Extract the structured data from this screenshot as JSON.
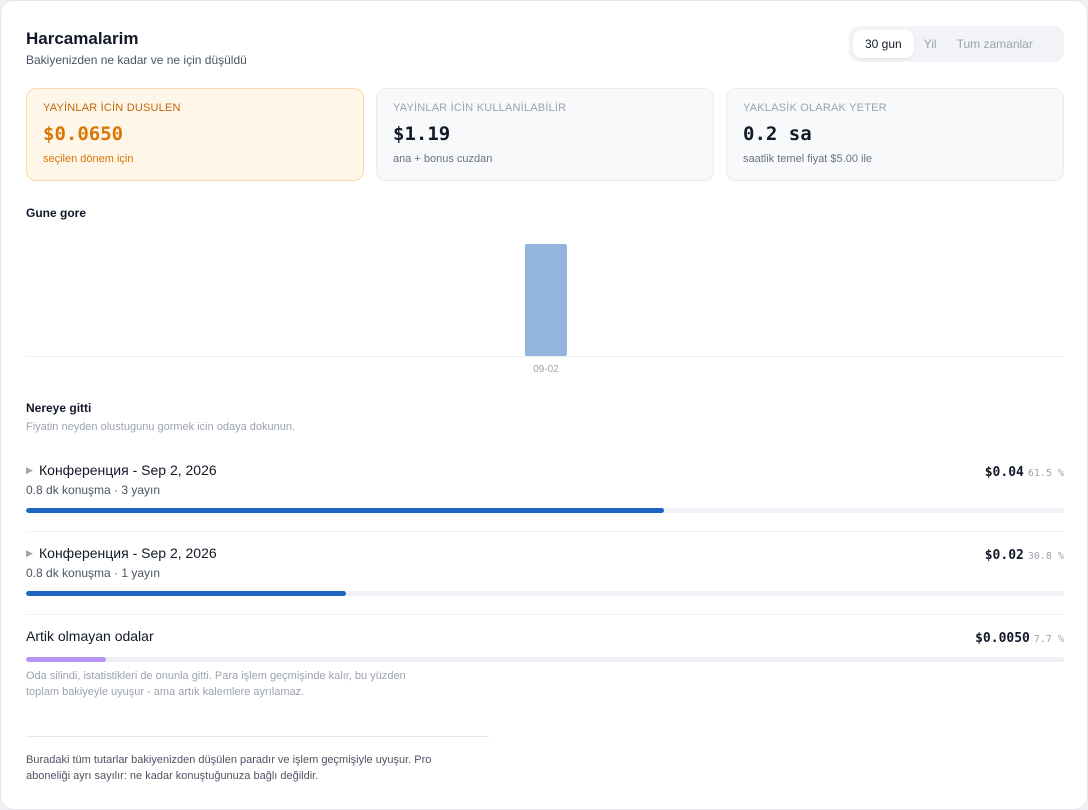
{
  "header": {
    "title": "Harcamalarim",
    "subtitle": "Bakiyenizden ne kadar ve ne için düşüldü"
  },
  "period_tabs": [
    {
      "label": "30 gun",
      "active": true
    },
    {
      "label": "Yil",
      "active": false
    },
    {
      "label": "Tum zamanlar",
      "active": false
    }
  ],
  "stats": [
    {
      "label": "YAYİNLAR İCİN DUSULEN",
      "value": "$0.0650",
      "note": "seçilen dönem için"
    },
    {
      "label": "YAYİNLAR İCİN KULLANİLABİLİR",
      "value": "$1.19",
      "note": "ana + bonus cuzdan"
    },
    {
      "label": "YAKLASİK OLARAK YETER",
      "value": "0.2 sa",
      "note": "saatlik temel fiyat $5.00 ile"
    }
  ],
  "by_day": {
    "title": "Gune gore"
  },
  "chart_data": {
    "type": "bar",
    "title": "Gune gore",
    "categories": [
      "09-02"
    ],
    "values": [
      0.065
    ],
    "xlabel": "",
    "ylabel": "",
    "ylim": [
      0,
      0.065
    ],
    "grid": false,
    "bar_color": "#93b4de"
  },
  "breakdown": {
    "title": "Nereye gitti",
    "subtitle": "Fiyatin neyden olustugunu gormek icin odaya dokunun.",
    "rooms": [
      {
        "name": "Конференция - Sep 2, 2026",
        "meta": "0.8 dk konuşma · 3 yayın",
        "amount": "$0.04",
        "percent_label": "61.5 %",
        "share": 0.615
      },
      {
        "name": "Конференция - Sep 2, 2026",
        "meta": "0.8 dk konuşma · 1 yayın",
        "amount": "$0.02",
        "percent_label": "30.8 %",
        "share": 0.308
      }
    ],
    "gone": {
      "name": "Artik olmayan odalar",
      "amount": "$0.0050",
      "percent_label": "7.7 %",
      "share": 0.077,
      "note": "Oda silindi, istatistikleri de onunla gitti. Para işlem geçmişinde kalır, bu yüzden toplam bakiyeyle uyuşur - ama artık kalemlere ayrılamaz."
    }
  },
  "footer_note": "Buradaki tüm tutarlar bakiyenizden düşülen paradır ve işlem geçmişiyle uyuşur. Pro aboneliği ayrı sayılır: ne kadar konuştuğunuza bağlı değildir.",
  "colors": {
    "accent_orange": "#d97706",
    "bar_blue": "#1d64c2",
    "bar_purple": "#b794f4"
  }
}
